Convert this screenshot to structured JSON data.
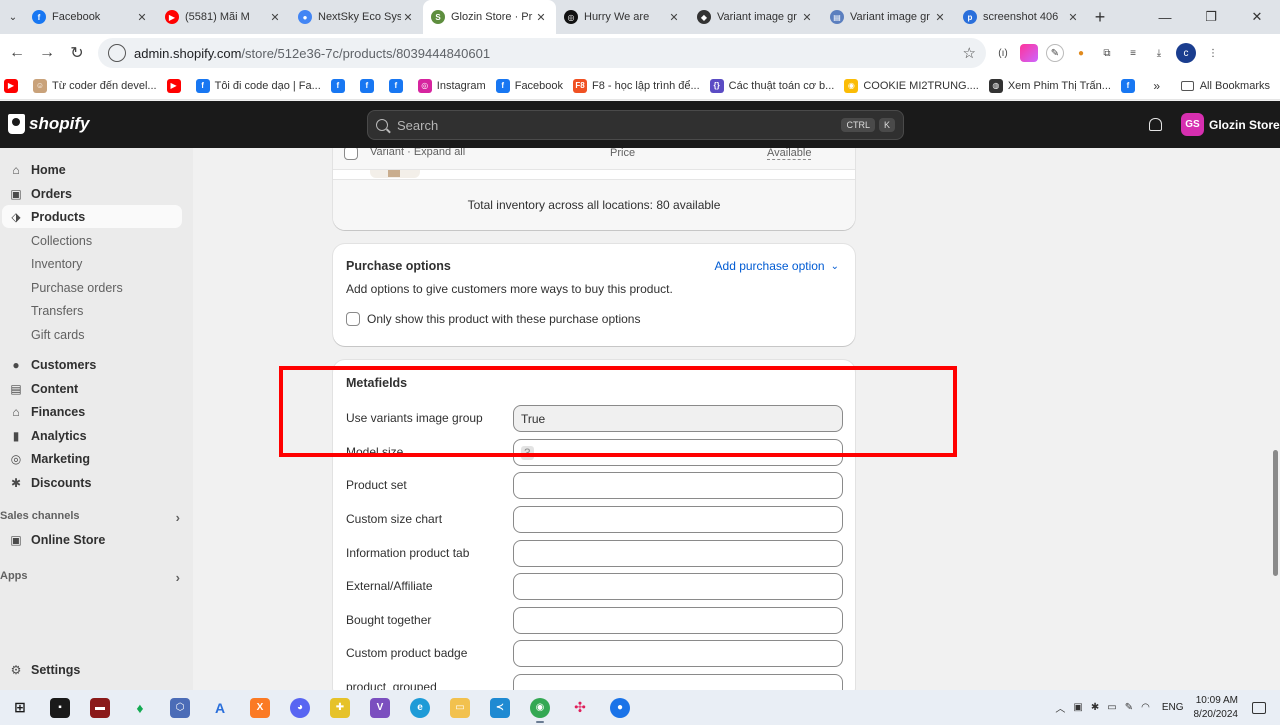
{
  "browser": {
    "tabs": [
      {
        "title": "Facebook",
        "icon": "facebook-icon",
        "color": "#1877f2",
        "glyph": "f"
      },
      {
        "title": "(5581) Mãi M",
        "icon": "youtube-icon",
        "color": "#ff0000",
        "glyph": "▶"
      },
      {
        "title": "NextSky Eco Sys",
        "icon": "nextsky-icon",
        "color": "#4285f4",
        "glyph": "●"
      },
      {
        "title": "Glozin Store · Pr",
        "icon": "shopify-icon",
        "color": "#5e8e3e",
        "glyph": "S"
      },
      {
        "title": "Hurry We are",
        "icon": "chatgpt-icon",
        "color": "#111111",
        "glyph": "◎"
      },
      {
        "title": "Variant image gr",
        "icon": "layers-icon",
        "color": "#333333",
        "glyph": "◆"
      },
      {
        "title": "Variant image gr",
        "icon": "doc-icon",
        "color": "#5b7fbf",
        "glyph": "▤"
      },
      {
        "title": "screenshot 406",
        "icon": "pinned-icon",
        "color": "#2a6fdb",
        "glyph": "p"
      }
    ],
    "active_tab_index": 3,
    "url_host": "admin.shopify.com",
    "url_path": "/store/512e36-7c/products/8039444840601"
  },
  "bookmarks": [
    {
      "label": "",
      "icon": "youtube-icon",
      "color": "#ff0000",
      "glyph": "▶"
    },
    {
      "label": "Từ coder đến devel...",
      "icon": "avatar-icon",
      "color": "#c9a27a",
      "glyph": "☺"
    },
    {
      "label": "",
      "icon": "youtube-icon",
      "color": "#ff0000",
      "glyph": "▶"
    },
    {
      "label": "Tôi đi code dạo | Fa...",
      "icon": "facebook-icon",
      "color": "#1877f2",
      "glyph": "f"
    },
    {
      "label": "",
      "icon": "facebook-icon",
      "color": "#1877f2",
      "glyph": "f"
    },
    {
      "label": "",
      "icon": "facebook-icon",
      "color": "#1877f2",
      "glyph": "f"
    },
    {
      "label": "",
      "icon": "facebook-icon",
      "color": "#1877f2",
      "glyph": "f"
    },
    {
      "label": "Instagram",
      "icon": "instagram-icon",
      "color": "#d6249f",
      "glyph": "◎"
    },
    {
      "label": "Facebook",
      "icon": "facebook-icon",
      "color": "#1877f2",
      "glyph": "f"
    },
    {
      "label": "F8 - học lập trình để...",
      "icon": "f8-icon",
      "color": "#f05123",
      "glyph": "F8"
    },
    {
      "label": "Các thuật toán cơ b...",
      "icon": "code-icon",
      "color": "#5b4cc4",
      "glyph": "{}"
    },
    {
      "label": "COOKIE MI2TRUNG....",
      "icon": "chrome-icon",
      "color": "#fbbc05",
      "glyph": "◉"
    },
    {
      "label": "Xem Phim Thị Trấn...",
      "icon": "globe-icon",
      "color": "#333333",
      "glyph": "◍"
    },
    {
      "label": "",
      "icon": "facebook-icon",
      "color": "#1877f2",
      "glyph": "f"
    }
  ],
  "bookmarks_more": "»",
  "all_bookmarks": "All Bookmarks",
  "shopify": {
    "logo_text": "shopify",
    "search_placeholder": "Search",
    "kbd_ctrl": "CTRL",
    "kbd_k": "K",
    "store_initials": "GS",
    "store_name": "Glozin Store",
    "store_color": "#d62fb0"
  },
  "sidebar": {
    "home": "Home",
    "orders": "Orders",
    "products": "Products",
    "product_sub": [
      "Collections",
      "Inventory",
      "Purchase orders",
      "Transfers",
      "Gift cards"
    ],
    "customers": "Customers",
    "content": "Content",
    "finances": "Finances",
    "analytics": "Analytics",
    "marketing": "Marketing",
    "discounts": "Discounts",
    "sales_channels": "Sales channels",
    "online_store": "Online Store",
    "apps": "Apps",
    "settings": "Settings"
  },
  "variants": {
    "header_variant": "Variant",
    "expand_all": "Expand all",
    "header_price": "Price",
    "header_available": "Available",
    "total_inventory": "Total inventory across all locations: 80 available"
  },
  "purchase_options": {
    "title": "Purchase options",
    "add_link": "Add purchase option",
    "description": "Add options to give customers more ways to buy this product.",
    "checkbox_label": "Only show this product with these purchase options"
  },
  "metafields": {
    "title": "Metafields",
    "rows": [
      {
        "label": "Use variants image group",
        "value": "True"
      },
      {
        "label": "Model size",
        "value": "3"
      },
      {
        "label": "Product set",
        "value": ""
      },
      {
        "label": "Custom size chart",
        "value": ""
      },
      {
        "label": "Information product tab",
        "value": ""
      },
      {
        "label": "External/Affiliate",
        "value": ""
      },
      {
        "label": "Bought together",
        "value": ""
      },
      {
        "label": "Custom product badge",
        "value": ""
      },
      {
        "label": "product_grouped",
        "value": ""
      }
    ]
  },
  "taskbar": {
    "lang": "ENG",
    "time": "10:09 AM",
    "date": "8/20/2024"
  }
}
